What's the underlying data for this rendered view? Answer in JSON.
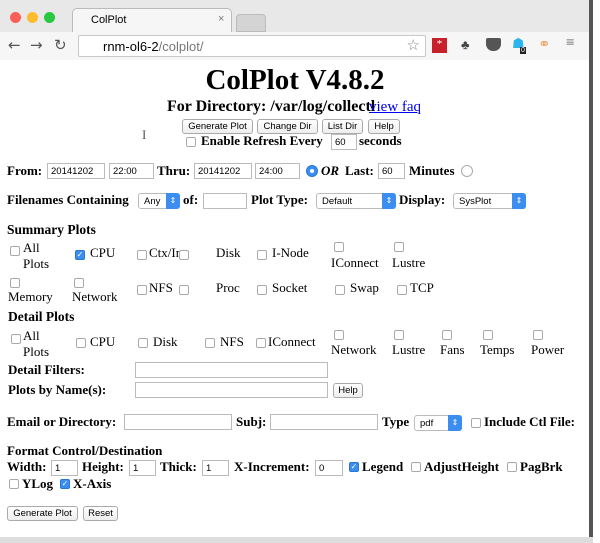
{
  "browser": {
    "tab_title": "ColPlot",
    "url_host": "rnm-ol6-2",
    "url_path": "/colplot/",
    "badge_count": "0"
  },
  "header": {
    "title": "ColPlot V4.8.2",
    "directory_label": "For Directory: /var/log/collectl",
    "faq_link": "view faq"
  },
  "top_buttons": {
    "generate": "Generate Plot",
    "change_dir": "Change Dir",
    "list_dir": "List Dir",
    "help": "Help"
  },
  "refresh": {
    "label": "Enable Refresh Every",
    "value": "60",
    "unit": "seconds",
    "checked": false
  },
  "time": {
    "from_label": "From:",
    "from_date": "20141202",
    "from_time": "22:00",
    "thru_label": "Thru:",
    "thru_date": "20141202",
    "thru_time": "24:00",
    "or_label": "OR",
    "last_label": "Last:",
    "last_value": "60",
    "minutes_label": "Minutes"
  },
  "filter": {
    "filenames_label": "Filenames Containing",
    "match_select": "Any",
    "of_label": "of:",
    "of_value": "",
    "plot_type_label": "Plot Type:",
    "plot_type": "Default",
    "display_label": "Display:",
    "display": "SysPlot"
  },
  "summary": {
    "heading": "Summary Plots",
    "items": [
      {
        "label": "All Plots",
        "checked": false
      },
      {
        "label": "CPU",
        "checked": true
      },
      {
        "label": "Ctx/Int",
        "checked": false
      },
      {
        "label": "Disk",
        "checked": false
      },
      {
        "label": "I-Node",
        "checked": false
      },
      {
        "label": "IConnect",
        "checked": false
      },
      {
        "label": "Lustre",
        "checked": false
      },
      {
        "label": "Memory",
        "checked": false
      },
      {
        "label": "Network",
        "checked": false
      },
      {
        "label": "NFS",
        "checked": false
      },
      {
        "label": "Proc",
        "checked": false
      },
      {
        "label": "Socket",
        "checked": false
      },
      {
        "label": "Swap",
        "checked": false
      },
      {
        "label": "TCP",
        "checked": false
      }
    ]
  },
  "detail": {
    "heading": "Detail Plots",
    "items": [
      {
        "label": "All Plots",
        "checked": false
      },
      {
        "label": "CPU",
        "checked": false
      },
      {
        "label": "Disk",
        "checked": false
      },
      {
        "label": "NFS",
        "checked": false
      },
      {
        "label": "IConnect",
        "checked": false
      },
      {
        "label": "Network",
        "checked": false
      },
      {
        "label": "Lustre",
        "checked": false
      },
      {
        "label": "Fans",
        "checked": false
      },
      {
        "label": "Temps",
        "checked": false
      },
      {
        "label": "Power",
        "checked": false
      }
    ],
    "filters_label": "Detail Filters:",
    "filters_value": "",
    "by_name_label": "Plots by Name(s):",
    "by_name_value": "",
    "help": "Help"
  },
  "email": {
    "label": "Email or Directory:",
    "value": "",
    "subj_label": "Subj:",
    "subj_value": "",
    "type_label": "Type",
    "type": "pdf",
    "include_label": "Include Ctl File:",
    "include_checked": false
  },
  "format": {
    "heading": "Format Control/Destination",
    "width_label": "Width:",
    "width": "1",
    "height_label": "Height:",
    "height": "1",
    "thick_label": "Thick:",
    "thick": "1",
    "xinc_label": "X-Increment:",
    "xinc": "0",
    "legend_label": "Legend",
    "legend": true,
    "adjust_label": "AdjustHeight",
    "adjust": false,
    "pagbrk_label": "PagBrk",
    "pagbrk": false,
    "ylog_label": "YLog",
    "ylog": false,
    "xaxis_label": "X-Axis",
    "xaxis": true
  },
  "bottom_buttons": {
    "generate": "Generate Plot",
    "reset": "Reset"
  }
}
